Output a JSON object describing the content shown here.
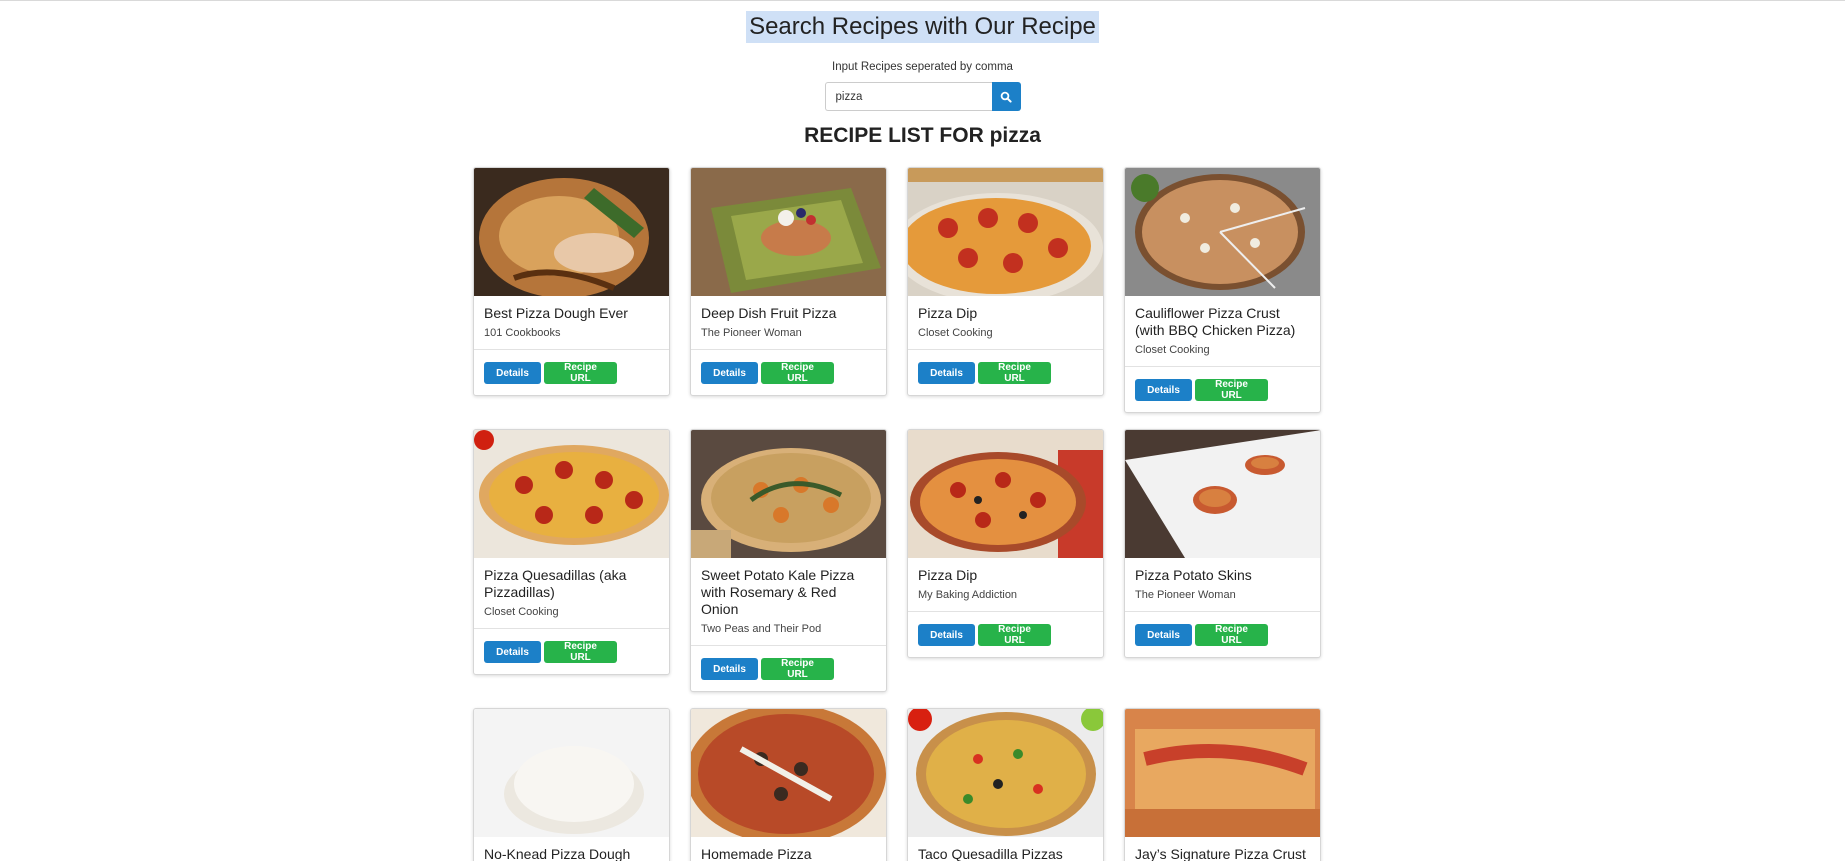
{
  "header": {
    "title": "Search Recipes with Our Recipe",
    "hint": "Input Recipes seperated by comma",
    "search_value": "pizza",
    "search_icon": "search-icon"
  },
  "list_heading": "RECIPE LIST FOR pizza",
  "colors": {
    "primary": "#1c80c8",
    "success": "#27b34a",
    "title_highlight": "#cfe0f6"
  },
  "buttons": {
    "details": "Details",
    "recipe_url": "Recipe URL"
  },
  "recipes": [
    {
      "title": "Best Pizza Dough Ever",
      "source": "101 Cookbooks"
    },
    {
      "title": "Deep Dish Fruit Pizza",
      "source": "The Pioneer Woman"
    },
    {
      "title": "Pizza Dip",
      "source": "Closet Cooking"
    },
    {
      "title": "Cauliflower Pizza Crust (with BBQ Chicken Pizza)",
      "source": "Closet Cooking"
    },
    {
      "title": "Pizza Quesadillas (aka Pizzadillas)",
      "source": "Closet Cooking"
    },
    {
      "title": "Sweet Potato Kale Pizza with Rosemary & Red Onion",
      "source": "Two Peas and Their Pod"
    },
    {
      "title": "Pizza Dip",
      "source": "My Baking Addiction"
    },
    {
      "title": "Pizza Potato Skins",
      "source": "The Pioneer Woman"
    },
    {
      "title": "No-Knead Pizza Dough",
      "source": ""
    },
    {
      "title": "Homemade Pizza",
      "source": ""
    },
    {
      "title": "Taco Quesadilla Pizzas",
      "source": ""
    },
    {
      "title": "Jay’s Signature Pizza Crust",
      "source": ""
    }
  ]
}
